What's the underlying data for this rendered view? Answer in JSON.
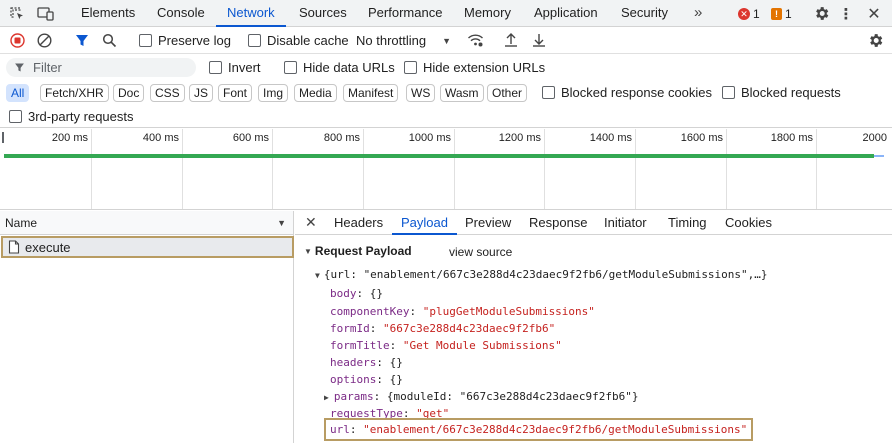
{
  "devtools_tabs": [
    "Elements",
    "Console",
    "Network",
    "Sources",
    "Performance",
    "Memory",
    "Application",
    "Security"
  ],
  "active_tab": "Network",
  "errors_count": "1",
  "warnings_count": "1",
  "toolbar": {
    "preserve_log": "Preserve log",
    "disable_cache": "Disable cache",
    "throttling": "No throttling"
  },
  "filter": {
    "placeholder": "Filter",
    "invert": "Invert",
    "hide_data_urls": "Hide data URLs",
    "hide_extension_urls": "Hide extension URLs"
  },
  "type_filters": [
    "All",
    "Fetch/XHR",
    "Doc",
    "CSS",
    "JS",
    "Font",
    "Img",
    "Media",
    "Manifest",
    "WS",
    "Wasm",
    "Other"
  ],
  "blocked_response_cookies": "Blocked response cookies",
  "blocked_requests": "Blocked requests",
  "third_party_requests": "3rd-party requests",
  "timeline_ticks": [
    "200 ms",
    "400 ms",
    "600 ms",
    "800 ms",
    "1000 ms",
    "1200 ms",
    "1400 ms",
    "1600 ms",
    "1800 ms",
    "2000"
  ],
  "requests_column": "Name",
  "request_name": "execute",
  "detail_tabs": [
    "Headers",
    "Payload",
    "Preview",
    "Response",
    "Initiator",
    "Timing",
    "Cookies"
  ],
  "active_detail_tab": "Payload",
  "payload": {
    "section_title": "Request Payload",
    "view_source": "view source",
    "summary": "{url: \"enablement/667c3e288d4c23daec9f2fb6/getModuleSubmissions\",…}",
    "rows": [
      {
        "key": "body",
        "value": "{}",
        "type": "plain"
      },
      {
        "key": "componentKey",
        "value": "\"plugGetModuleSubmissions\"",
        "type": "string"
      },
      {
        "key": "formId",
        "value": "\"667c3e288d4c23daec9f2fb6\"",
        "type": "string"
      },
      {
        "key": "formTitle",
        "value": "\"Get Module Submissions\"",
        "type": "string"
      },
      {
        "key": "headers",
        "value": "{}",
        "type": "plain"
      },
      {
        "key": "options",
        "value": "{}",
        "type": "plain"
      },
      {
        "key": "params",
        "value": "{moduleId: \"667c3e288d4c23daec9f2fb6\"}",
        "type": "plain"
      },
      {
        "key": "requestType",
        "value": "\"get\"",
        "type": "string"
      },
      {
        "key": "url",
        "value": "\"enablement/667c3e288d4c23daec9f2fb6/getModuleSubmissions\"",
        "type": "string"
      }
    ]
  },
  "colors": {
    "accent": "#0b57d0",
    "string": "#c5221f",
    "key": "#7b2a86",
    "highlight_border": "#b89c63",
    "timeline_bar": "#34a853"
  }
}
